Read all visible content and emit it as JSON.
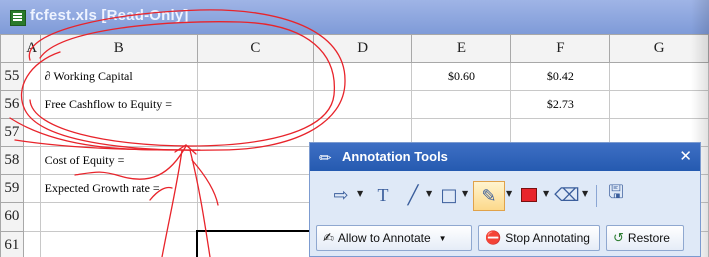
{
  "window": {
    "title": "fcfest.xls  [Read-Only]"
  },
  "columns": [
    "A",
    "B",
    "C",
    "D",
    "E",
    "F",
    "G"
  ],
  "rows": [
    {
      "num": "55",
      "B": "∂ Working Capital",
      "E": "$0.60",
      "F": "$0.42"
    },
    {
      "num": "56",
      "B": "Free Cashflow to Equity =",
      "E": "",
      "F": "$2.73"
    },
    {
      "num": "57",
      "B": "",
      "E": "",
      "F": ""
    },
    {
      "num": "58",
      "B": "Cost of Equity =",
      "E": "",
      "F": ""
    },
    {
      "num": "59",
      "B": "Expected Growth rate =",
      "E": "",
      "F": ""
    },
    {
      "num": "60",
      "B": "",
      "E": "",
      "F": ""
    },
    {
      "num": "61",
      "B": "",
      "E": "",
      "F": ""
    }
  ],
  "annotation_panel": {
    "title": "Annotation Tools",
    "buttons": {
      "allow": "Allow to Annotate",
      "stop": "Stop Annotating",
      "restore": "Restore"
    },
    "colors": {
      "header": "#2d62b8",
      "ink": "#e8242b",
      "selected_tool": "#fcd98b"
    }
  }
}
